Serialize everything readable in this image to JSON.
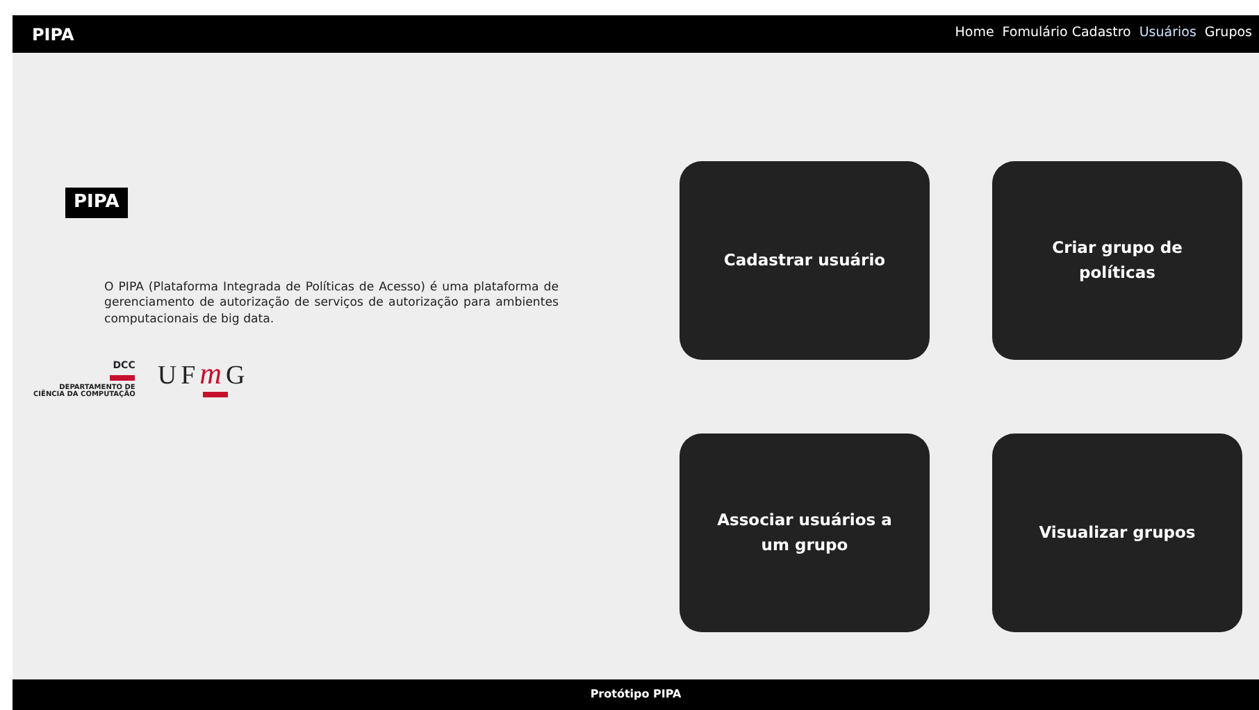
{
  "navbar": {
    "brand": "PIPA",
    "links": [
      {
        "label": "Home",
        "selected": false
      },
      {
        "label": "Fomulário Cadastro",
        "selected": false
      },
      {
        "label": "Usuários",
        "selected": true
      },
      {
        "label": "Grupos",
        "selected": false
      }
    ]
  },
  "intro": {
    "badge": "PIPA",
    "text": "O PIPA (Plataforma Integrada de Políticas de Acesso) é uma plataforma de gerenciamento de autorização de serviços de autorização para ambientes computacionais de big data.",
    "logos": {
      "dcc": "DCC",
      "dcc_line_1": "DEPARTAMENTO DE",
      "dcc_line_2": "CIÊNCIA DA COMPUTAÇÃO",
      "ufmg_1": "UF",
      "ufmg_2": "m",
      "ufmg_3": "G"
    }
  },
  "cards": [
    {
      "label": "Cadastrar usuário"
    },
    {
      "label": "Criar grupo de políticas"
    },
    {
      "label": "Associar usuários a um grupo"
    },
    {
      "label": "Visualizar grupos"
    }
  ],
  "footer": "Protótipo PIPA"
}
